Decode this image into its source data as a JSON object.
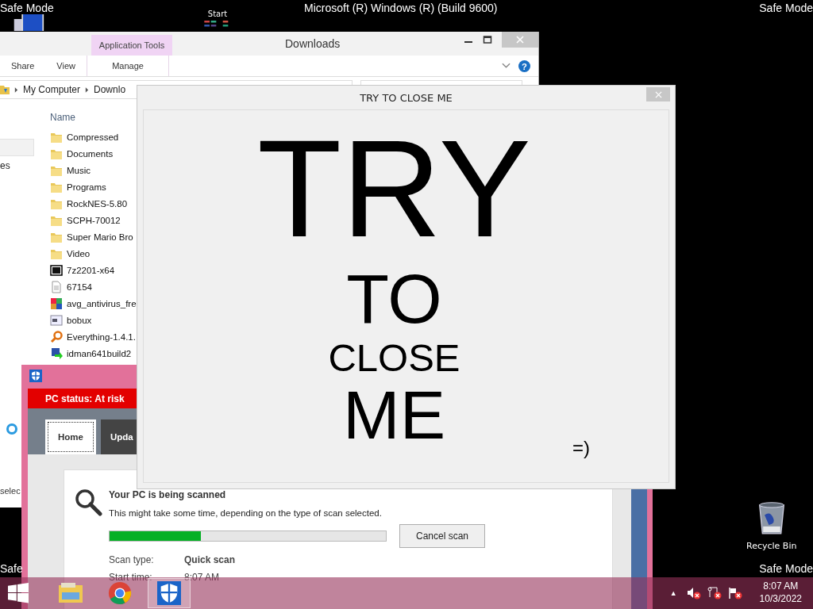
{
  "desktop": {
    "corner_labels": [
      "Safe Mode",
      "Safe Mode",
      "Safe",
      "Safe Mode"
    ],
    "build_label": "Microsoft (R) Windows (R) (Build 9600)",
    "icons": [
      {
        "kind": "start",
        "label": "Start"
      },
      {
        "kind": "recycle",
        "label": "Recycle Bin"
      }
    ]
  },
  "explorer": {
    "title": "Downloads",
    "context_group": "Application Tools",
    "ribbon_tabs": [
      {
        "label": "Share",
        "selected": false
      },
      {
        "label": "View",
        "selected": false
      },
      {
        "label": "Manage",
        "selected": false
      }
    ],
    "breadcrumb": [
      "My Computer",
      "Downlo"
    ],
    "nav_items": [
      "es"
    ],
    "column": "Name",
    "status": "selec",
    "help_glyph": "?",
    "files": [
      {
        "name": "Compressed",
        "kind": "folder"
      },
      {
        "name": "Documents",
        "kind": "folder"
      },
      {
        "name": "Music",
        "kind": "folder"
      },
      {
        "name": "Programs",
        "kind": "folder"
      },
      {
        "name": "RockNES-5.80",
        "kind": "folder"
      },
      {
        "name": "SCPH-70012",
        "kind": "folder"
      },
      {
        "name": "Super Mario Bro",
        "kind": "folder"
      },
      {
        "name": "Video",
        "kind": "folder"
      },
      {
        "name": "7z2201-x64",
        "kind": "archiver"
      },
      {
        "name": "67154",
        "kind": "document"
      },
      {
        "name": "avg_antivirus_fre",
        "kind": "antivirus"
      },
      {
        "name": "bobux",
        "kind": "window"
      },
      {
        "name": "Everything-1.4.1.",
        "kind": "magnifier"
      },
      {
        "name": "idman641build2",
        "kind": "installer"
      }
    ]
  },
  "defender": {
    "status": "PC status: At risk",
    "tabs": [
      {
        "label": "Home",
        "selected": true
      },
      {
        "label": "Upda",
        "selected": false
      }
    ],
    "scan_title": "Your PC is being scanned",
    "scan_note": "This might take some time, depending on the type of scan selected.",
    "progress": {
      "level": 0.33
    },
    "cancel_button": "Cancel scan",
    "details": [
      {
        "label": "Scan type:",
        "value": "Quick scan"
      },
      {
        "label": "Start time:",
        "value": "8:07 AM"
      }
    ]
  },
  "popup": {
    "title": "TRY TO CLOSE ME",
    "lines": [
      "TRY",
      "TO",
      "CLOSE",
      "ME"
    ],
    "smiley": "=)"
  },
  "taskbar": {
    "apps": [
      {
        "kind": "explorer",
        "selected": false
      },
      {
        "kind": "chrome",
        "selected": false
      },
      {
        "kind": "defender",
        "selected": true
      }
    ],
    "tray_arrow": "▲",
    "time": "8:07 AM",
    "date": "10/3/2022"
  }
}
